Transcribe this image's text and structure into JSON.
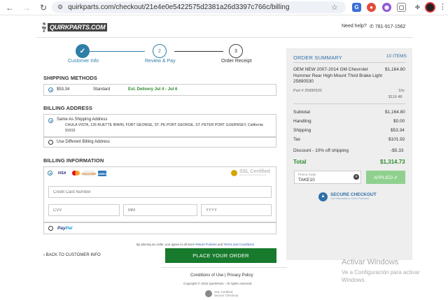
{
  "browser": {
    "url": "quirkparts.com/checkout/21e4e0e5422575d2381a26d3397c766c/billing"
  },
  "header": {
    "logo": "QUIRKPARTS.COM",
    "help": "Need help?",
    "phone": "781-917-1562"
  },
  "steps": [
    {
      "num": "✓",
      "label": "Customer Info"
    },
    {
      "num": "2",
      "label": "Review & Pay"
    },
    {
      "num": "3",
      "label": "Order Receipt"
    }
  ],
  "shipping": {
    "title": "SHIPPING METHODS",
    "price": "$53.34",
    "method": "Standard",
    "delivery": "Est. Delivery Jul 4 - Jul 6"
  },
  "billing_address": {
    "title": "BILLING ADDRESS",
    "same_label": "Same As Shipping Address",
    "address_line1": "CHULA VISTA, 126 RUETTE IRWIN, FORT GEORGE, ST. PE PORT GEORGE, ST. PETER PORT GUERNSEY, California",
    "address_line2": "91915",
    "different_label": "Use Different Billing Address"
  },
  "billing_info": {
    "title": "BILLING INFORMATION",
    "cards": [
      "VISA",
      "",
      "DISCOVER",
      "AMEX"
    ],
    "ssl": "SSL Certified",
    "ssl_sub": "Secure Credit Card Payment",
    "card_number_placeholder": "Credit Card Number",
    "cvv_placeholder": "CVV",
    "mm_placeholder": "MM",
    "yyyy_placeholder": "YYYY",
    "paypal_1": "Pay",
    "paypal_2": "Pal"
  },
  "actions": {
    "terms_prefix": "By placing an order, you agree to all store",
    "return_policies": "Return Policies",
    "and": "and",
    "terms_conditions": "Terms and Conditions",
    "back": "‹ BACK TO CUSTOMER INFO",
    "place_order": "PLACE YOUR ORDER"
  },
  "footer": {
    "conditions": "Conditions of Use",
    "separator": " | ",
    "privacy": "Privacy Policy",
    "copyright": "Copyright © 2025 QuirkParts - All rights reserved",
    "seal_1": "SSL Certified",
    "seal_2": "Secure Checkout"
  },
  "summary": {
    "title": "ORDER SUMMARY",
    "items_count": "10 ITEMS",
    "product_name": "OEM NEW 2007-2014 GM Chevrolet Hummer Rear High Mount Third Brake Light 25890530",
    "product_price": "$1,164.80",
    "part_no": "Part # 25890530",
    "qty": "10x",
    "unit_price": "$116.48",
    "rows": [
      {
        "label": "Subtotal",
        "value": "$1,164.80"
      },
      {
        "label": "Handling",
        "value": "$0.00"
      },
      {
        "label": "Shipping",
        "value": "$53.34"
      },
      {
        "label": "Tax",
        "value": "$101.92"
      },
      {
        "label": "Discount - 10% off shipping",
        "value": "-$5.33"
      }
    ],
    "total_label": "Total",
    "total_value": "$1,314.73",
    "promo_label": "Promo Code",
    "promo_value": "TAKE10",
    "apply": "APPLIED ✔",
    "secure": "SECURE CHECKOUT",
    "secure_sub": "Your information is 100% Protected"
  },
  "watermark": {
    "title": "Activar Windows",
    "sub": "Ve a Configuración para activar Windows."
  }
}
